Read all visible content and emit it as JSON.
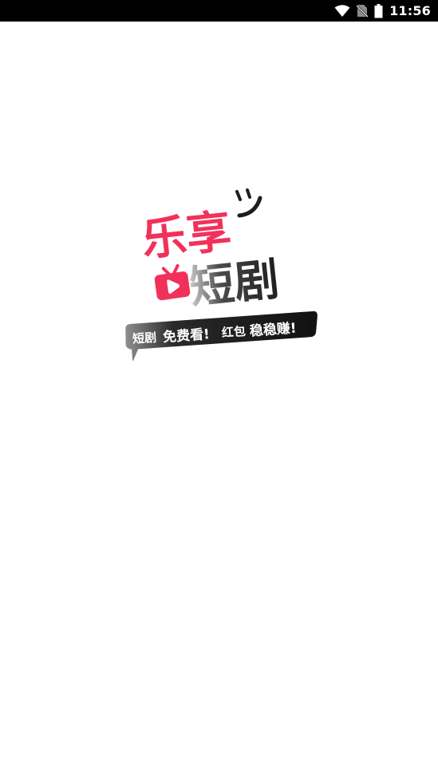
{
  "status_bar": {
    "time": "11:56",
    "icons": [
      "wifi-icon",
      "no-sim-icon",
      "battery-icon"
    ]
  },
  "splash": {
    "logo_line1": "乐享",
    "logo_line2": "短剧",
    "slogan_part1": "短剧",
    "slogan_part2": "免费看!",
    "slogan_part3": "红包",
    "slogan_part4": "稳稳赚!",
    "colors": {
      "brand_red": "#F2315A",
      "dark": "#1E1E1E",
      "slogan_bg": "#111111",
      "slogan_text": "#FFFFFF"
    }
  }
}
